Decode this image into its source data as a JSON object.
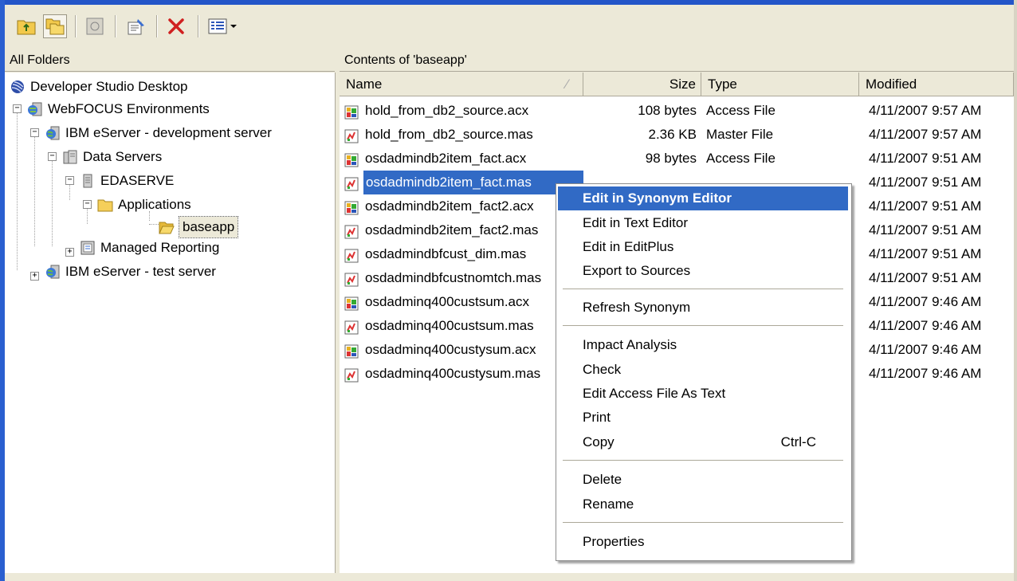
{
  "toolbar": {
    "buttons": [
      {
        "icon": "folder-up-icon"
      },
      {
        "icon": "folders-view-icon"
      },
      {
        "icon": "disk-icon"
      },
      {
        "icon": "properties-icon"
      },
      {
        "icon": "delete-icon"
      },
      {
        "icon": "view-options-icon"
      }
    ]
  },
  "left_pane": {
    "header": "All Folders",
    "tree": [
      {
        "label": "Developer Studio Desktop",
        "icon": "desktop-icon"
      },
      {
        "label": "WebFOCUS Environments",
        "icon": "environments-icon"
      },
      {
        "label": "IBM eServer - development server",
        "icon": "globe-server-icon"
      },
      {
        "label": "Data Servers",
        "icon": "data-servers-icon"
      },
      {
        "label": "EDASERVE",
        "icon": "server-icon"
      },
      {
        "label": "Applications",
        "icon": "folder-icon"
      },
      {
        "label": "baseapp",
        "icon": "folder-open-icon"
      },
      {
        "label": "Managed Reporting",
        "icon": "managed-reporting-icon"
      },
      {
        "label": "IBM eServer - test server",
        "icon": "globe-server-icon"
      }
    ]
  },
  "right_pane": {
    "header": "Contents of 'baseapp'",
    "columns": {
      "name": "Name",
      "size": "Size",
      "type": "Type",
      "modified": "Modified"
    },
    "files": [
      {
        "name": "hold_from_db2_source.acx",
        "size": "108 bytes",
        "type": "Access File",
        "modified": "4/11/2007 9:57 AM",
        "icon": "access-file-icon"
      },
      {
        "name": "hold_from_db2_source.mas",
        "size": "2.36 KB",
        "type": "Master File",
        "modified": "4/11/2007 9:57 AM",
        "icon": "master-file-icon"
      },
      {
        "name": "osdadmindb2item_fact.acx",
        "size": "98 bytes",
        "type": "Access File",
        "modified": "4/11/2007 9:51 AM",
        "icon": "access-file-icon"
      },
      {
        "name": "osdadmindb2item_fact.mas",
        "size": "",
        "type": "",
        "modified": "4/11/2007 9:51 AM",
        "icon": "master-file-icon"
      },
      {
        "name": "osdadmindb2item_fact2.acx",
        "size": "",
        "type": "",
        "modified": "4/11/2007 9:51 AM",
        "icon": "access-file-icon"
      },
      {
        "name": "osdadmindb2item_fact2.mas",
        "size": "",
        "type": "",
        "modified": "4/11/2007 9:51 AM",
        "icon": "master-file-icon"
      },
      {
        "name": "osdadmindbfcust_dim.mas",
        "size": "",
        "type": "",
        "modified": "4/11/2007 9:51 AM",
        "icon": "master-file-icon"
      },
      {
        "name": "osdadmindbfcustnomtch.mas",
        "size": "",
        "type": "",
        "modified": "4/11/2007 9:51 AM",
        "icon": "master-file-icon"
      },
      {
        "name": "osdadminq400custsum.acx",
        "size": "",
        "type": "",
        "modified": "4/11/2007 9:46 AM",
        "icon": "access-file-icon"
      },
      {
        "name": "osdadminq400custsum.mas",
        "size": "",
        "type": "",
        "modified": "4/11/2007 9:46 AM",
        "icon": "master-file-icon"
      },
      {
        "name": "osdadminq400custysum.acx",
        "size": "",
        "type": "",
        "modified": "4/11/2007 9:46 AM",
        "icon": "access-file-icon"
      },
      {
        "name": "osdadminq400custysum.mas",
        "size": "",
        "type": "",
        "modified": "4/11/2007 9:46 AM",
        "icon": "master-file-icon"
      }
    ]
  },
  "context_menu": {
    "items": [
      {
        "label": "Edit in Synonym Editor",
        "shortcut": ""
      },
      {
        "label": "Edit in Text Editor",
        "shortcut": ""
      },
      {
        "label": "Edit in EditPlus",
        "shortcut": ""
      },
      {
        "label": "Export to Sources",
        "shortcut": ""
      },
      {
        "label": "Refresh Synonym",
        "shortcut": ""
      },
      {
        "label": "Impact Analysis",
        "shortcut": ""
      },
      {
        "label": "Check",
        "shortcut": ""
      },
      {
        "label": "Edit Access File As Text",
        "shortcut": ""
      },
      {
        "label": "Print",
        "shortcut": ""
      },
      {
        "label": "Copy",
        "shortcut": "Ctrl-C"
      },
      {
        "label": "Delete",
        "shortcut": ""
      },
      {
        "label": "Rename",
        "shortcut": ""
      },
      {
        "label": "Properties",
        "shortcut": ""
      }
    ]
  },
  "colors": {
    "selection": "#316ac5",
    "window_bg": "#ece9d8",
    "frame": "#2355c8"
  }
}
